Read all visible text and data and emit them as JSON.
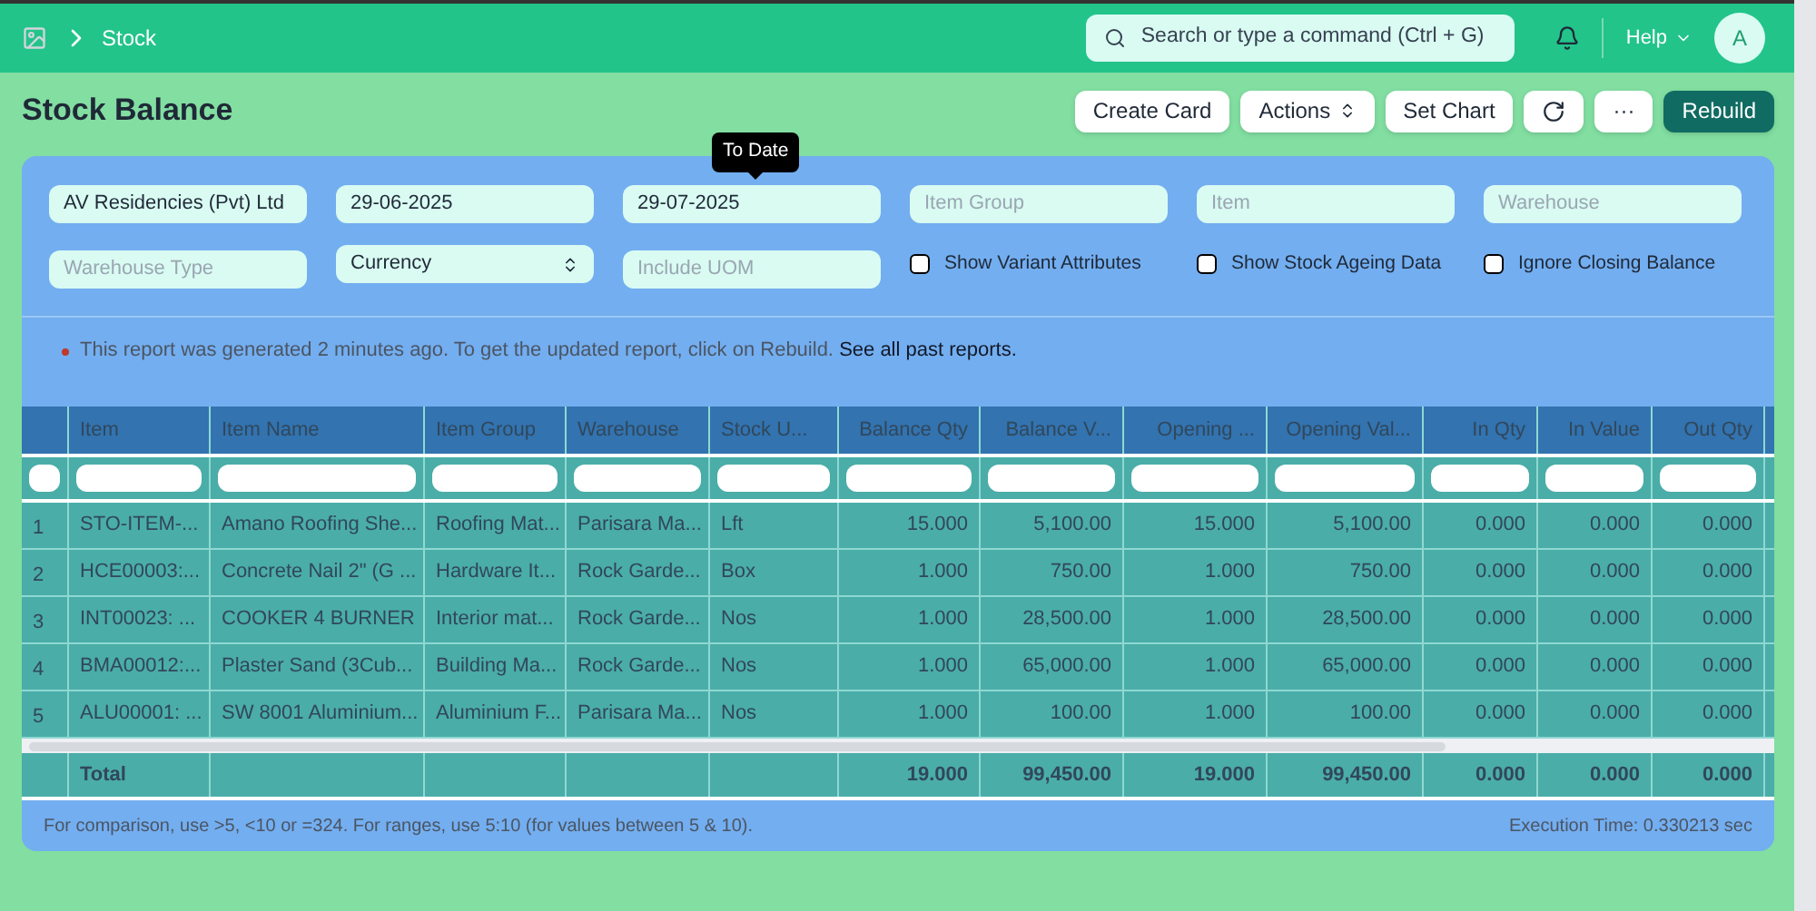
{
  "navbar": {
    "breadcrumb": "Stock",
    "search": {
      "placeholder": "Search or type a command (Ctrl + G)"
    },
    "help": "Help",
    "avatar": "A"
  },
  "page": {
    "title": "Stock Balance",
    "buttons": [
      {
        "label": "Create Card",
        "kind": "text"
      },
      {
        "label": "Actions",
        "kind": "dropdown"
      },
      {
        "label": "Set Chart",
        "kind": "text"
      },
      {
        "kind": "refresh"
      },
      {
        "label": "···",
        "kind": "text"
      },
      {
        "label": "Rebuild",
        "kind": "primary"
      }
    ]
  },
  "tooltip": "To Date",
  "filters": [
    {
      "kind": "input",
      "value": "AV Residencies (Pvt) Ltd"
    },
    {
      "kind": "input",
      "value": "29-06-2025"
    },
    {
      "kind": "input",
      "value": "29-07-2025"
    },
    {
      "kind": "input",
      "placeholder": "Item Group"
    },
    {
      "kind": "input",
      "placeholder": "Item"
    },
    {
      "kind": "input",
      "placeholder": "Warehouse"
    },
    {
      "kind": "input",
      "placeholder": "Warehouse Type"
    },
    {
      "kind": "select",
      "value": "Currency"
    },
    {
      "kind": "input",
      "placeholder": "Include UOM"
    },
    {
      "kind": "checkbox",
      "label": "Show Variant Attributes",
      "checked": false
    },
    {
      "kind": "checkbox",
      "label": "Show Stock Ageing Data",
      "checked": false
    },
    {
      "kind": "checkbox",
      "label": "Ignore Closing Balance",
      "checked": false
    }
  ],
  "notice": {
    "text": "This report was generated 2 minutes ago. To get the updated report, click on Rebuild.",
    "link": "See all past reports."
  },
  "table": {
    "columns": [
      {
        "label": "Item",
        "kind": "text"
      },
      {
        "label": "Item Name",
        "kind": "text"
      },
      {
        "label": "Item Group",
        "kind": "text"
      },
      {
        "label": "Warehouse",
        "kind": "text"
      },
      {
        "label": "Stock U...",
        "kind": "text"
      },
      {
        "label": "Balance Qty",
        "kind": "number"
      },
      {
        "label": "Balance V...",
        "kind": "number"
      },
      {
        "label": "Opening ...",
        "kind": "number"
      },
      {
        "label": "Opening Val...",
        "kind": "number"
      },
      {
        "label": "In Qty",
        "kind": "number"
      },
      {
        "label": "In Value",
        "kind": "number"
      },
      {
        "label": "Out Qty",
        "kind": "number"
      }
    ],
    "rows": [
      {
        "index": "1",
        "cells": [
          "STO-ITEM-...",
          "Amano Roofing She...",
          "Roofing Mat...",
          "Parisara Ma...",
          "Lft",
          "15.000",
          "5,100.00",
          "15.000",
          "5,100.00",
          "0.000",
          "0.000",
          "0.000"
        ]
      },
      {
        "index": "2",
        "cells": [
          "HCE00003:...",
          "Concrete Nail 2\" (G ...",
          "Hardware It...",
          "Rock Garde...",
          "Box",
          "1.000",
          "750.00",
          "1.000",
          "750.00",
          "0.000",
          "0.000",
          "0.000"
        ]
      },
      {
        "index": "3",
        "cells": [
          "INT00023: ...",
          "COOKER 4 BURNER",
          "Interior mat...",
          "Rock Garde...",
          "Nos",
          "1.000",
          "28,500.00",
          "1.000",
          "28,500.00",
          "0.000",
          "0.000",
          "0.000"
        ]
      },
      {
        "index": "4",
        "cells": [
          "BMA00012:...",
          "Plaster Sand (3Cub...",
          "Building Ma...",
          "Rock Garde...",
          "Nos",
          "1.000",
          "65,000.00",
          "1.000",
          "65,000.00",
          "0.000",
          "0.000",
          "0.000"
        ]
      },
      {
        "index": "5",
        "cells": [
          "ALU00001: ...",
          "SW 8001 Aluminium...",
          "Aluminium F...",
          "Parisara Ma...",
          "Nos",
          "1.000",
          "100.00",
          "1.000",
          "100.00",
          "0.000",
          "0.000",
          "0.000"
        ]
      }
    ],
    "total": {
      "label": "Total",
      "cells": [
        "",
        "",
        "",
        "",
        "",
        "19.000",
        "99,450.00",
        "19.000",
        "99,450.00",
        "0.000",
        "0.000",
        "0.000"
      ]
    }
  },
  "footer": {
    "hint": "For comparison, use >5, <10 or =324. For ranges, use 5:10 (for values between 5 & 10).",
    "execution_time": "Execution Time: 0.330213 sec"
  }
}
